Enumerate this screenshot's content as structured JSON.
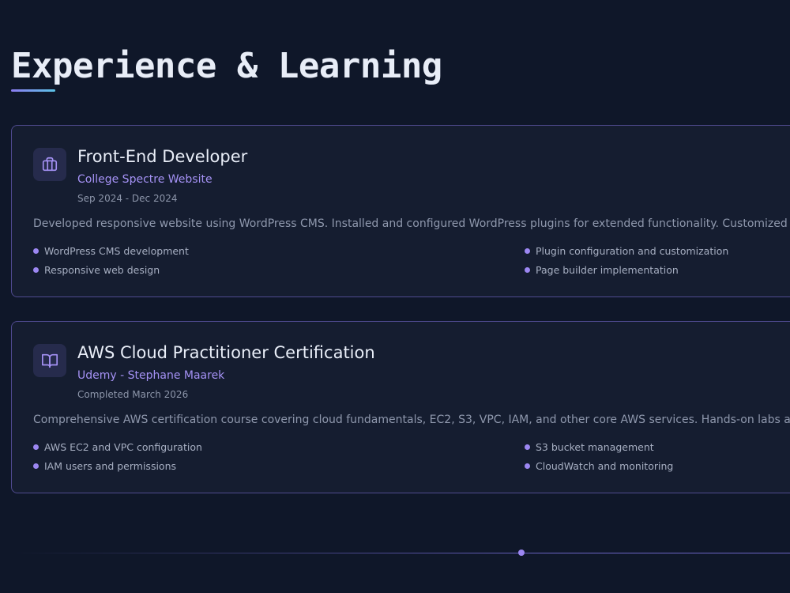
{
  "section": {
    "title": "Experience & Learning"
  },
  "cards": [
    {
      "icon": "briefcase-icon",
      "title": "Front-End Developer",
      "subtitle": "College Spectre Website",
      "date": "Sep 2024 - Dec 2024",
      "description": "Developed responsive website using WordPress CMS. Installed and configured WordPress plugins for extended functionality. Customized themes and layou",
      "bullets": [
        "WordPress CMS development",
        "Plugin configuration and customization",
        "Responsive web design",
        "Page builder implementation"
      ]
    },
    {
      "icon": "book-open-icon",
      "title": "AWS Cloud Practitioner Certification",
      "subtitle": "Udemy - Stephane Maarek",
      "date": "Completed March 2026",
      "description": "Comprehensive AWS certification course covering cloud fundamentals, EC2, S3, VPC, IAM, and other core AWS services. Hands-on labs and real-world scena",
      "bullets": [
        "AWS EC2 and VPC configuration",
        "S3 bucket management",
        "IAM users and permissions",
        "CloudWatch and monitoring"
      ]
    }
  ],
  "colors": {
    "background": "#0f1729",
    "card_background": "#151d30",
    "card_border": "#4f4a8f",
    "accent": "#a592f5",
    "bullet_dot": "#9c87f2"
  }
}
